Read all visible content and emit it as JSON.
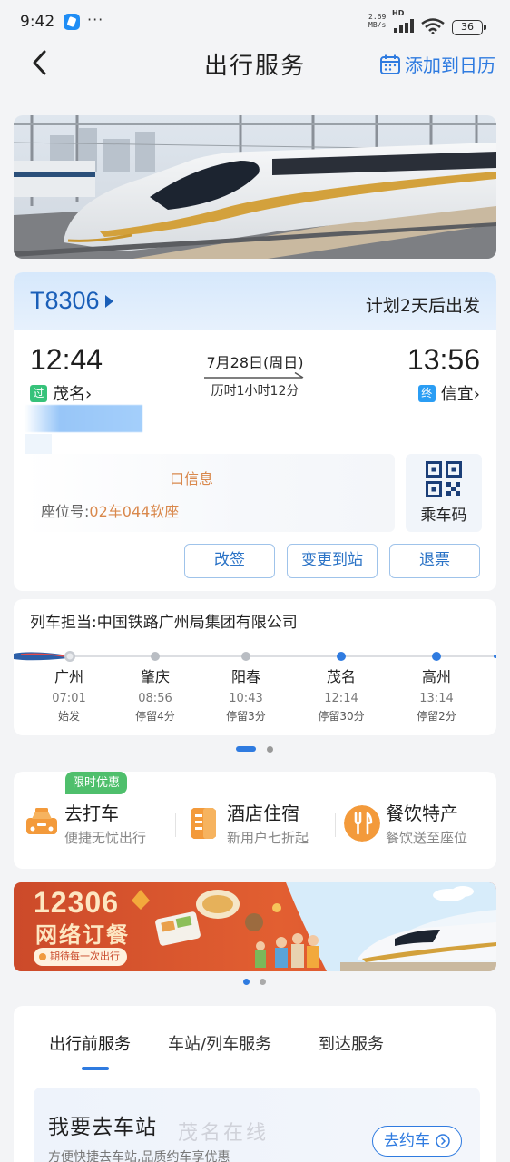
{
  "status_bar": {
    "time": "9:42",
    "more": "···",
    "net_speed_value": "2.69",
    "net_speed_unit": "MB/s",
    "hd": "HD",
    "battery": "36"
  },
  "nav": {
    "title": "出行服务",
    "add_calendar": "添加到日历"
  },
  "ticket": {
    "train_no": "T8306",
    "departure_plan": "计划2天后出发",
    "depart_time": "12:44",
    "depart_tag": "过",
    "depart_station": "茂名›",
    "arrive_time": "13:56",
    "arrive_tag": "终",
    "arrive_station": "信宜›",
    "date": "7月28日(周日)",
    "duration": "历时1小时12分",
    "gate_info": "口信息",
    "seat_label": "座位号:",
    "seat_value": "02车044软座",
    "qr_label": "乘车码",
    "actions": [
      "改签",
      "变更到站",
      "退票"
    ]
  },
  "route": {
    "operator": "列车担当:中国铁路广州局集团有限公司",
    "stops": [
      {
        "name": "广州",
        "time": "07:01",
        "info": "始发"
      },
      {
        "name": "肇庆",
        "time": "08:56",
        "info": "停留4分"
      },
      {
        "name": "阳春",
        "time": "10:43",
        "info": "停留3分"
      },
      {
        "name": "茂名",
        "time": "12:14",
        "info": "停留30分"
      },
      {
        "name": "高州",
        "time": "13:14",
        "info": "停留2分"
      }
    ]
  },
  "services": {
    "promo_tag": "限时优惠",
    "items": [
      {
        "title": "去打车",
        "subtitle": "便捷无忧出行",
        "icon": "taxi-icon"
      },
      {
        "title": "酒店住宿",
        "subtitle": "新用户七折起",
        "icon": "hotel-icon"
      },
      {
        "title": "餐饮特产",
        "subtitle": "餐饮送至座位",
        "icon": "dining-icon"
      }
    ]
  },
  "ad": {
    "number": "12306",
    "title": "网络订餐",
    "slogan": "期待每一次出行"
  },
  "tabs": {
    "items": [
      "出行前服务",
      "车站/列车服务",
      "到达服务"
    ],
    "active": "出行前服务"
  },
  "station_card": {
    "title": "我要去车站",
    "subtitle": "方便快捷去车站,品质约车享优惠",
    "button": "去约车"
  },
  "watermark": "茂名在线",
  "colors": {
    "accent": "#2f7be0",
    "seat_orange": "#d9884c",
    "promo_green": "#4fbf6c"
  }
}
